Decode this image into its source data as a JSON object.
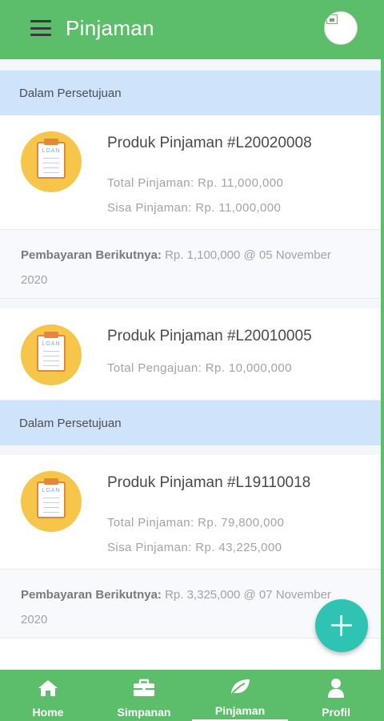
{
  "app": {
    "title": "Pinjaman"
  },
  "sections": [
    {
      "header": "Dalam Persetujuan",
      "cards": [
        {
          "title": "Produk Pinjaman #L20020008",
          "line1": "Total Pinjaman: Rp. 11,000,000",
          "line2": "Sisa Pinjaman: Rp. 11,000,000",
          "next_payment_label": "Pembayaran Berikutnya:",
          "next_payment_value": "Rp. 1,100,000 @ 05 November 2020"
        },
        {
          "title": "Produk Pinjaman #L20010005",
          "line1": "Total Pengajuan: Rp. 10,000,000"
        }
      ]
    },
    {
      "header": "Dalam Persetujuan",
      "cards": [
        {
          "title": "Produk Pinjaman #L19110018",
          "line1": "Total Pinjaman: Rp. 79,800,000",
          "line2": "Sisa Pinjaman: Rp. 43,225,000",
          "next_payment_label": "Pembayaran Berikutnya:",
          "next_payment_value": "Rp. 3,325,000 @ 07 November 2020"
        }
      ]
    }
  ],
  "icon_text": "LOAN",
  "nav": {
    "items": [
      {
        "label": "Home",
        "icon": "home-icon"
      },
      {
        "label": "Simpanan",
        "icon": "briefcase-icon"
      },
      {
        "label": "Pinjaman",
        "icon": "leaf-icon"
      },
      {
        "label": "Profil",
        "icon": "person-icon"
      }
    ],
    "active": "Pinjaman"
  },
  "colors": {
    "primary": "#5cbd6a",
    "section_bg": "#cfe3fb",
    "fab": "#2fc3b3",
    "loan_icon": "#f6c64a"
  }
}
